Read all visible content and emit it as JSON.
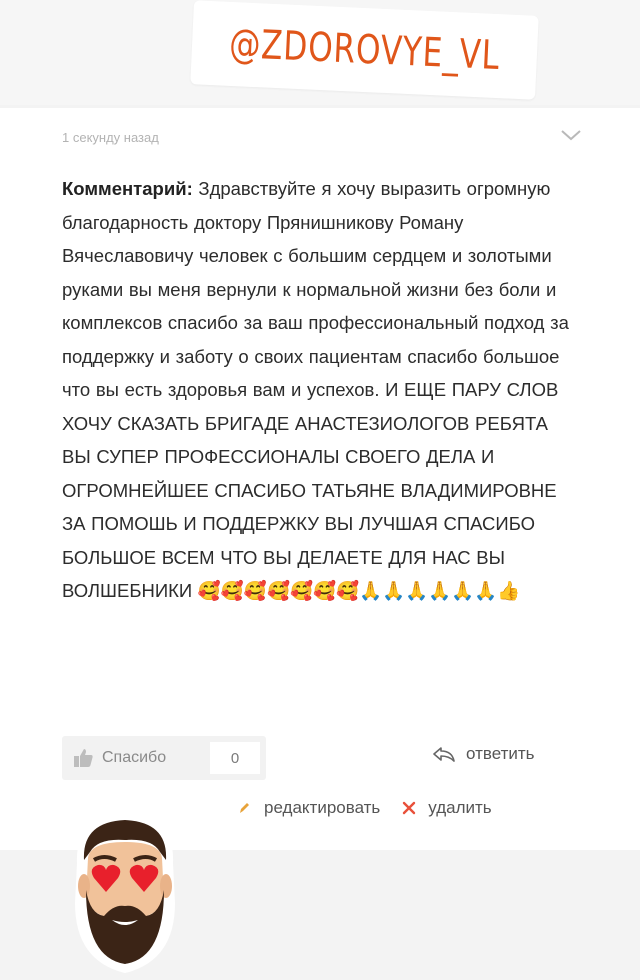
{
  "sticker": {
    "handle": "@ZDOROVYE_VL"
  },
  "comment": {
    "timestamp": "1 секунду назад",
    "label": "Комментарий:",
    "body": "Здравствуйте я хочу выразить огромную благодарность доктору Прянишникову Роману Вячеславовичу человек с большим сердцем и золотыми руками вы меня вернули к нормальной жизни без боли и комплексов спасибо за ваш профессиональный подход за поддержку и заботу о своих пациентам спасибо большое что вы есть здоровья вам и успехов. И ЕЩЕ ПАРУ СЛОВ ХОЧУ СКАЗАТЬ БРИГАДЕ АНАСТЕЗИОЛОГОВ РЕБЯТА ВЫ СУПЕР ПРОФЕССИОНАЛЫ СВОЕГО ДЕЛА И ОГРОМНЕЙШЕЕ СПАСИБО ТАТЬЯНЕ ВЛАДИМИРОВНЕ ЗА ПОМОШЬ И ПОДДЕРЖКУ ВЫ ЛУЧШАЯ СПАСИБО БОЛЬШОЕ ВСЕМ ЧТО ВЫ ДЕЛАЕТЕ ДЛЯ НАС ВЫ ВОЛШЕБНИКИ",
    "emoji_line": "🥰🥰🥰🥰🥰🥰🥰🙏🙏🙏🙏🙏🙏👍"
  },
  "actions": {
    "thanks_label": "Спасибо",
    "thanks_count": "0",
    "reply_label": "ответить",
    "edit_label": "редактировать",
    "delete_label": "удалить"
  },
  "colors": {
    "handle": "#e0561a",
    "text": "#2c2c2c",
    "muted": "#b3b3b3",
    "delete_x": "#e8503a"
  }
}
